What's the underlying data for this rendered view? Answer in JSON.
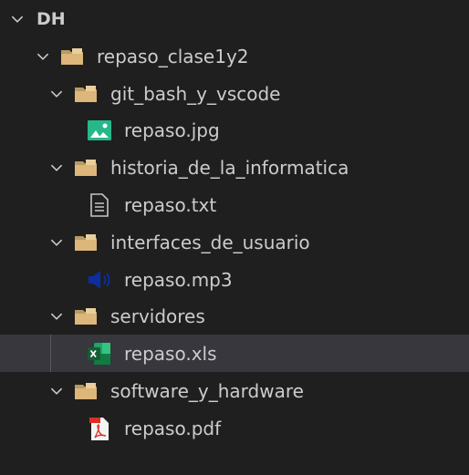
{
  "explorer": {
    "root": "DH",
    "items": [
      {
        "label": "repaso_clase1y2",
        "type": "folder",
        "level": 1
      },
      {
        "label": "git_bash_y_vscode",
        "type": "folder",
        "level": 2
      },
      {
        "label": "repaso.jpg",
        "type": "image",
        "level": 3
      },
      {
        "label": "historia_de_la_informatica",
        "type": "folder",
        "level": 2
      },
      {
        "label": "repaso.txt",
        "type": "text",
        "level": 3
      },
      {
        "label": "interfaces_de_usuario",
        "type": "folder",
        "level": 2
      },
      {
        "label": "repaso.mp3",
        "type": "audio",
        "level": 3
      },
      {
        "label": "servidores",
        "type": "folder",
        "level": 2
      },
      {
        "label": "repaso.xls",
        "type": "excel",
        "level": 3,
        "selected": true
      },
      {
        "label": "software_y_hardware",
        "type": "folder",
        "level": 2
      },
      {
        "label": "repaso.pdf",
        "type": "pdf",
        "level": 3
      }
    ]
  },
  "colors": {
    "background": "#1f1f1f",
    "selected": "#37373d",
    "folder": "#dcb67a",
    "image": "#26b88a",
    "audio": "#0b2ea0",
    "excel": "#1d7a45",
    "pdf": "#d93025"
  }
}
